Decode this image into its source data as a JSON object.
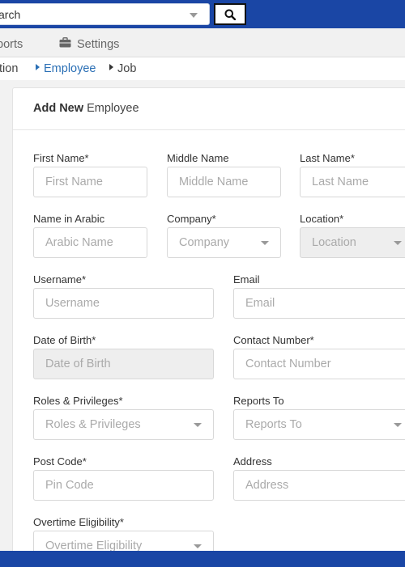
{
  "search": {
    "value": "arch"
  },
  "nav": {
    "reports": "ports",
    "settings": "Settings"
  },
  "breadcrumb": {
    "prev": "tion",
    "employee": "Employee",
    "job": "Job"
  },
  "card": {
    "title_bold": "Add New",
    "title_rest": "Employee"
  },
  "form": {
    "first_name": {
      "label": "First Name*",
      "placeholder": "First Name"
    },
    "middle_name": {
      "label": "Middle Name",
      "placeholder": "Middle Name"
    },
    "last_name": {
      "label": "Last Name*",
      "placeholder": "Last Name"
    },
    "name_arabic": {
      "label": "Name in Arabic",
      "placeholder": "Arabic Name"
    },
    "company": {
      "label": "Company*",
      "placeholder": "Company"
    },
    "location": {
      "label": "Location*",
      "placeholder": "Location"
    },
    "username": {
      "label": "Username*",
      "placeholder": "Username"
    },
    "email": {
      "label": "Email",
      "placeholder": "Email"
    },
    "dob": {
      "label": "Date of Birth*",
      "placeholder": "Date of Birth"
    },
    "contact": {
      "label": "Contact Number*",
      "placeholder": "Contact Number"
    },
    "roles": {
      "label": "Roles & Privileges*",
      "placeholder": "Roles & Privileges"
    },
    "reports_to": {
      "label": "Reports To",
      "placeholder": "Reports To"
    },
    "post_code": {
      "label": "Post Code*",
      "placeholder": "Pin Code"
    },
    "address": {
      "label": "Address",
      "placeholder": "Address"
    },
    "overtime": {
      "label": "Overtime Eligibility*",
      "placeholder": "Overtime Eligibility"
    }
  },
  "colors": {
    "brand": "#1a46a5",
    "link": "#2a6fb5"
  }
}
